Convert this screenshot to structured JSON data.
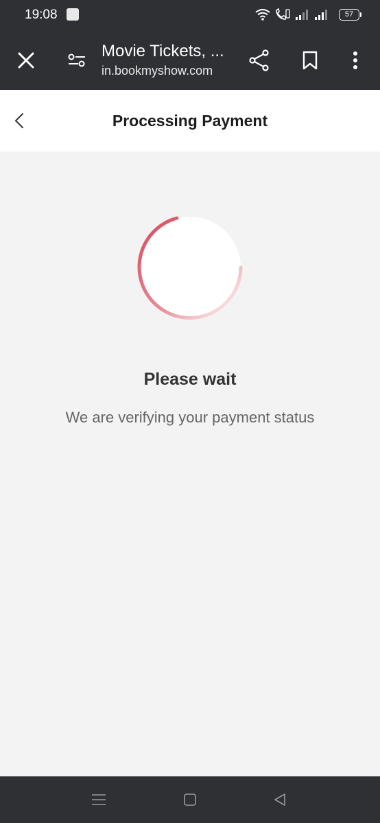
{
  "status_bar": {
    "time": "19:08",
    "battery": "57"
  },
  "browser": {
    "title": "Movie Tickets, ...",
    "url": "in.bookmyshow.com"
  },
  "page": {
    "title": "Processing Payment"
  },
  "main": {
    "heading": "Please wait",
    "subtext": "We are verifying your payment status"
  },
  "colors": {
    "spinner_accent": "#d9475a",
    "chrome_bg": "#2e3034",
    "page_bg": "#f3f3f3"
  },
  "icons": {
    "close": "close-icon",
    "page_settings": "sliders-icon",
    "share": "share-icon",
    "bookmark": "bookmark-icon",
    "menu": "more-vertical-icon",
    "back": "chevron-left-icon",
    "nav_recents": "menu-icon",
    "nav_home": "square-icon",
    "nav_back": "triangle-back-icon"
  }
}
